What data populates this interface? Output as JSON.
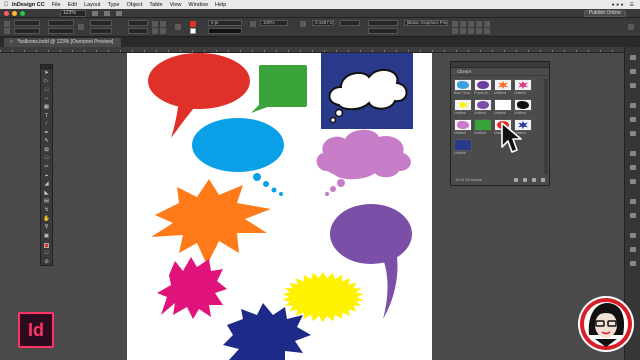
{
  "menubar": {
    "app_name": "InDesign CC",
    "items": [
      "File",
      "Edit",
      "Layout",
      "Type",
      "Object",
      "Table",
      "View",
      "Window",
      "Help"
    ],
    "right_text": "☰"
  },
  "appbar": {
    "zoom": "123%",
    "publish_label": "Publish Online"
  },
  "control": {
    "stroke_weight": "0 pt",
    "width_field": "0.1667 in",
    "frame_style": "[Basic Graphics Frame]+",
    "opacity": "100%"
  },
  "document": {
    "tab_label": "*balloons.indd @ 123% [Overprint Preview]",
    "close_glyph": "×"
  },
  "library": {
    "title": "ClientA",
    "status": "13 of 13 shown",
    "items": [
      {
        "caption": "Blue Thou...",
        "color": "#3aa0e0",
        "shape": "cloud"
      },
      {
        "caption": "Purple B...",
        "color": "#6a3ea0",
        "shape": "oval"
      },
      {
        "caption": "Untitled",
        "color": "#ff6a2a",
        "shape": "burst"
      },
      {
        "caption": "Untitled",
        "color": "#e0358a",
        "shape": "burst"
      },
      {
        "caption": "Untitled",
        "color": "#f5f500",
        "shape": "burst"
      },
      {
        "caption": "Untitled",
        "color": "#7b4fa8",
        "shape": "oval"
      },
      {
        "caption": "Untitled",
        "color": "#ffffff",
        "shape": "box"
      },
      {
        "caption": "Untitled",
        "color": "#111111",
        "shape": "cloud"
      },
      {
        "caption": "Untitled",
        "color": "#c77dc7",
        "shape": "cloud"
      },
      {
        "caption": "Untitled",
        "color": "#3aa43a",
        "shape": "box"
      },
      {
        "caption": "Untitled",
        "color": "#e0302a",
        "shape": "oval"
      },
      {
        "caption": "Untitled",
        "color": "#2a3aa0",
        "shape": "burst"
      },
      {
        "caption": "Untitled",
        "color": "#2a3a8a",
        "shape": "box"
      }
    ]
  },
  "logo": {
    "text": "Id",
    "color": "#ff3366"
  }
}
